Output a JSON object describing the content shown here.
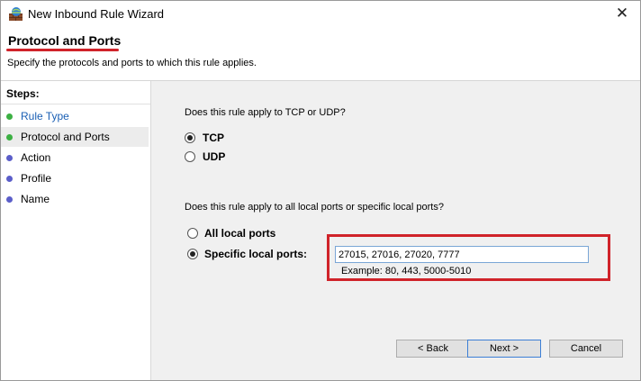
{
  "window": {
    "title": "New Inbound Rule Wizard",
    "close_glyph": "✕"
  },
  "header": {
    "title": "Protocol and Ports",
    "subtitle": "Specify the protocols and ports to which this rule applies."
  },
  "steps": {
    "heading": "Steps:",
    "items": [
      {
        "label": "Rule Type",
        "state": "done"
      },
      {
        "label": "Protocol and Ports",
        "state": "current"
      },
      {
        "label": "Action",
        "state": "pending"
      },
      {
        "label": "Profile",
        "state": "pending"
      },
      {
        "label": "Name",
        "state": "pending"
      }
    ]
  },
  "protocol": {
    "question": "Does this rule apply to TCP or UDP?",
    "options": [
      {
        "label": "TCP",
        "selected": true
      },
      {
        "label": "UDP",
        "selected": false
      }
    ]
  },
  "ports": {
    "question": "Does this rule apply to all local ports or specific local ports?",
    "options": [
      {
        "label": "All local ports",
        "selected": false
      },
      {
        "label": "Specific local ports:",
        "selected": true
      }
    ],
    "value": "27015, 27016, 27020, 7777",
    "example": "Example: 80, 443, 5000-5010"
  },
  "buttons": {
    "back": "< Back",
    "next": "Next >",
    "cancel": "Cancel"
  },
  "colors": {
    "highlight": "#d0232a",
    "step_done": "#3cb043",
    "step_pending": "#5b5ec9",
    "content_bg": "#f0f0f0"
  }
}
